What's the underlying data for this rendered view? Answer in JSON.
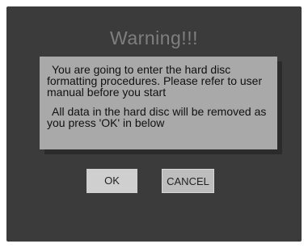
{
  "dialog": {
    "title": "Warning!!!",
    "message_line1": "You are going to enter the hard disc formatting procedures. Please refer to user manual before you start",
    "message_line2": "All data in the hard disc will be removed as you press 'OK' in below"
  },
  "buttons": {
    "ok_label": "OK",
    "cancel_label": "CANCEL"
  },
  "colors": {
    "background": "#3b3b3b",
    "message_box": "#a9a9a9",
    "title": "#7f7f7f",
    "button": "#c4c4c4"
  }
}
